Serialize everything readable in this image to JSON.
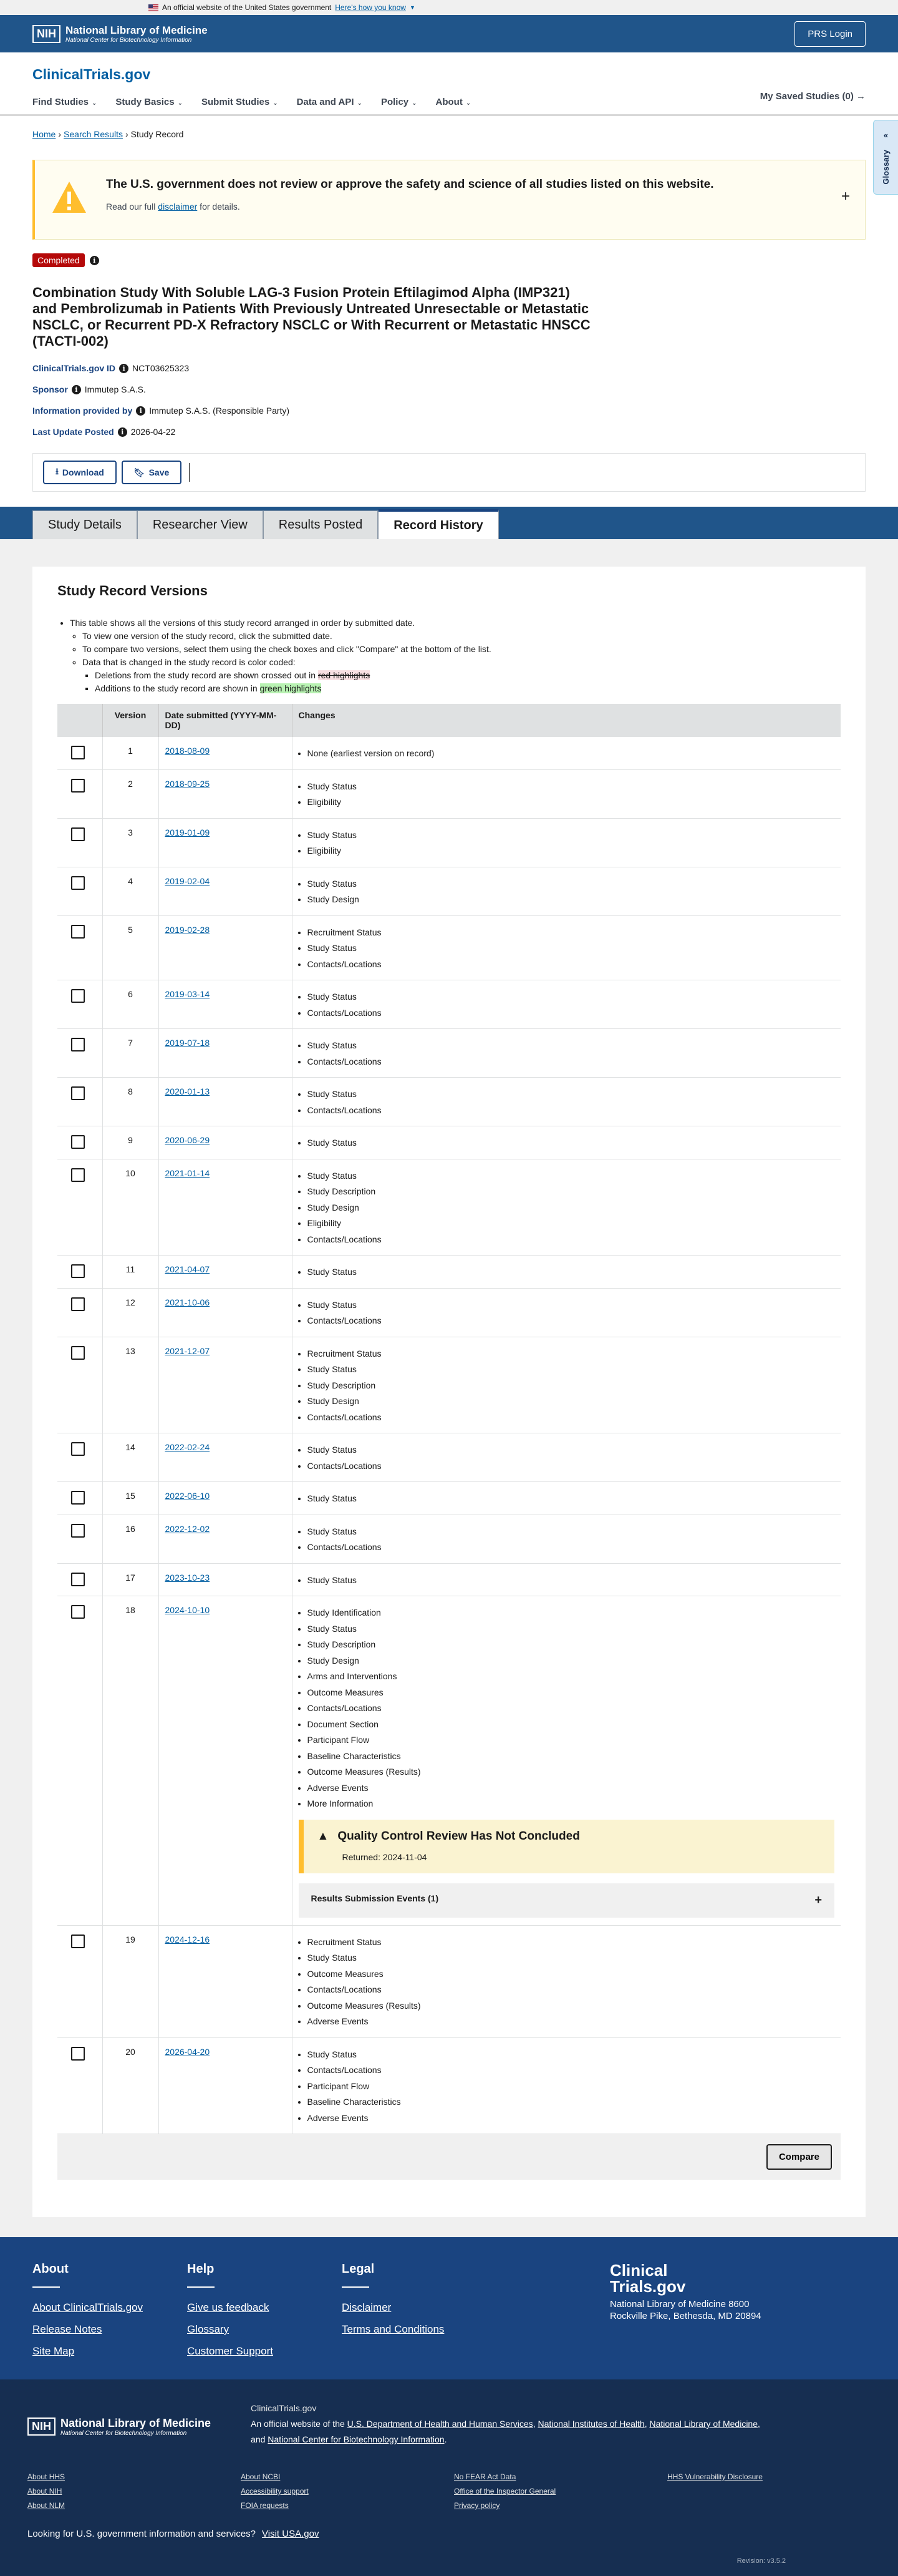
{
  "gov_banner": {
    "text": "An official website of the United States government",
    "link": "Here's how you know"
  },
  "nih": {
    "box": "NIH",
    "title": "National Library of Medicine",
    "subtitle": "National Center for Biotechnology Information",
    "prs_login": "PRS Login"
  },
  "site": {
    "logo": "ClinicalTrials.gov",
    "nav": [
      "Find Studies",
      "Study Basics",
      "Submit Studies",
      "Data and API",
      "Policy",
      "About"
    ],
    "saved": "My Saved Studies (0) →",
    "glossary": "Glossary"
  },
  "breadcrumb": [
    "Home",
    "Search Results",
    "Study Record"
  ],
  "alert": {
    "title": "The U.S. government does not review or approve the safety and science of all studies listed on this website.",
    "body_pre": "Read our full ",
    "body_link": "disclaimer",
    "body_post": " for details."
  },
  "study": {
    "status": "Completed",
    "title": "Combination Study With Soluble LAG-3 Fusion Protein Eftilagimod Alpha (IMP321) and Pembrolizumab in Patients With Previously Untreated Unresectable or Metastatic NSCLC, or Recurrent PD-X Refractory NSCLC or With Recurrent or Metastatic HNSCC (TACTI-002)",
    "id_label": "ClinicalTrials.gov ID",
    "id_value": "NCT03625323",
    "sponsor_label": "Sponsor",
    "sponsor_value": "Immutep S.A.S.",
    "info_label": "Information provided by",
    "info_value": "Immutep S.A.S. (Responsible Party)",
    "update_label": "Last Update Posted",
    "update_value": "2026-04-22"
  },
  "actions": {
    "download": "Download",
    "save": "Save"
  },
  "tabs": [
    "Study Details",
    "Researcher View",
    "Results Posted",
    "Record History"
  ],
  "versions_card": {
    "heading": "Study Record Versions",
    "intro": "This table shows all the versions of this study record arranged in order by submitted date.",
    "sub1": "To view one version of the study record, click the submitted date.",
    "sub2": "To compare two versions, select them using the check boxes and click \"Compare\" at the bottom of the list.",
    "sub3": "Data that is changed in the study record is color coded:",
    "del_pre": "Deletions from the study record are shown crossed out in ",
    "del_hl": "red highlights",
    "add_pre": "Additions to the study record are shown in ",
    "add_hl": "green highlights",
    "col_version": "Version",
    "col_date": "Date submitted (YYYY-MM-DD)",
    "col_changes": "Changes",
    "compare": "Compare"
  },
  "versions": [
    {
      "v": "1",
      "date": "2018-08-09",
      "changes": [
        "None (earliest version on record)"
      ]
    },
    {
      "v": "2",
      "date": "2018-09-25",
      "changes": [
        "Study Status",
        "Eligibility"
      ]
    },
    {
      "v": "3",
      "date": "2019-01-09",
      "changes": [
        "Study Status",
        "Eligibility"
      ]
    },
    {
      "v": "4",
      "date": "2019-02-04",
      "changes": [
        "Study Status",
        "Study Design"
      ]
    },
    {
      "v": "5",
      "date": "2019-02-28",
      "changes": [
        "Recruitment Status",
        "Study Status",
        "Contacts/Locations"
      ]
    },
    {
      "v": "6",
      "date": "2019-03-14",
      "changes": [
        "Study Status",
        "Contacts/Locations"
      ]
    },
    {
      "v": "7",
      "date": "2019-07-18",
      "changes": [
        "Study Status",
        "Contacts/Locations"
      ]
    },
    {
      "v": "8",
      "date": "2020-01-13",
      "changes": [
        "Study Status",
        "Contacts/Locations"
      ]
    },
    {
      "v": "9",
      "date": "2020-06-29",
      "changes": [
        "Study Status"
      ]
    },
    {
      "v": "10",
      "date": "2021-01-14",
      "changes": [
        "Study Status",
        "Study Description",
        "Study Design",
        "Eligibility",
        "Contacts/Locations"
      ]
    },
    {
      "v": "11",
      "date": "2021-04-07",
      "changes": [
        "Study Status"
      ]
    },
    {
      "v": "12",
      "date": "2021-10-06",
      "changes": [
        "Study Status",
        "Contacts/Locations"
      ]
    },
    {
      "v": "13",
      "date": "2021-12-07",
      "changes": [
        "Recruitment Status",
        "Study Status",
        "Study Description",
        "Study Design",
        "Contacts/Locations"
      ]
    },
    {
      "v": "14",
      "date": "2022-02-24",
      "changes": [
        "Study Status",
        "Contacts/Locations"
      ]
    },
    {
      "v": "15",
      "date": "2022-06-10",
      "changes": [
        "Study Status"
      ]
    },
    {
      "v": "16",
      "date": "2022-12-02",
      "changes": [
        "Study Status",
        "Contacts/Locations"
      ]
    },
    {
      "v": "17",
      "date": "2023-10-23",
      "changes": [
        "Study Status"
      ]
    },
    {
      "v": "18",
      "date": "2024-10-10",
      "changes": [
        "Study Identification",
        "Study Status",
        "Study Description",
        "Study Design",
        "Arms and Interventions",
        "Outcome Measures",
        "Contacts/Locations",
        "Document Section",
        "Participant Flow",
        "Baseline Characteristics",
        "Outcome Measures (Results)",
        "Adverse Events",
        "More Information"
      ],
      "qc": {
        "title": "Quality Control Review Has Not Concluded",
        "returned": "Returned: 2024-11-04",
        "events": "Results Submission Events (1)"
      }
    },
    {
      "v": "19",
      "date": "2024-12-16",
      "changes": [
        "Recruitment Status",
        "Study Status",
        "Outcome Measures",
        "Contacts/Locations",
        "Outcome Measures (Results)",
        "Adverse Events"
      ]
    },
    {
      "v": "20",
      "date": "2026-04-20",
      "changes": [
        "Study Status",
        "Contacts/Locations",
        "Participant Flow",
        "Baseline Characteristics",
        "Adverse Events"
      ]
    }
  ],
  "footer": {
    "cols": [
      {
        "title": "About",
        "links": [
          "About ClinicalTrials.gov",
          "Release Notes",
          "Site Map"
        ]
      },
      {
        "title": "Help",
        "links": [
          "Give us feedback",
          "Glossary",
          "Customer Support"
        ]
      },
      {
        "title": "Legal",
        "links": [
          "Disclaimer",
          "Terms and Conditions"
        ]
      }
    ],
    "brand": "Clinical Trials.gov",
    "address": "National Library of Medicine 8600 Rockville Pike, Bethesda, MD 20894"
  },
  "nlm_footer": {
    "site": "ClinicalTrials.gov",
    "official_pre": "An official website of the ",
    "hhs": "U.S. Department of Health and Human Services",
    "nih": "National Institutes of Health",
    "nlm": "National Library of Medicine",
    "and": "and",
    "ncbi": "National Center for Biotechnology Information",
    "links": [
      "About HHS",
      "About NCBI",
      "No FEAR Act Data",
      "HHS Vulnerability Disclosure",
      "About NIH",
      "Accessibility support",
      "Office of the Inspector General",
      "",
      "About NLM",
      "FOIA requests",
      "Privacy policy",
      ""
    ],
    "usa_text": "Looking for U.S. government information and services?",
    "usa_link": "Visit USA.gov",
    "revision": "Revision: v3.5.2"
  }
}
